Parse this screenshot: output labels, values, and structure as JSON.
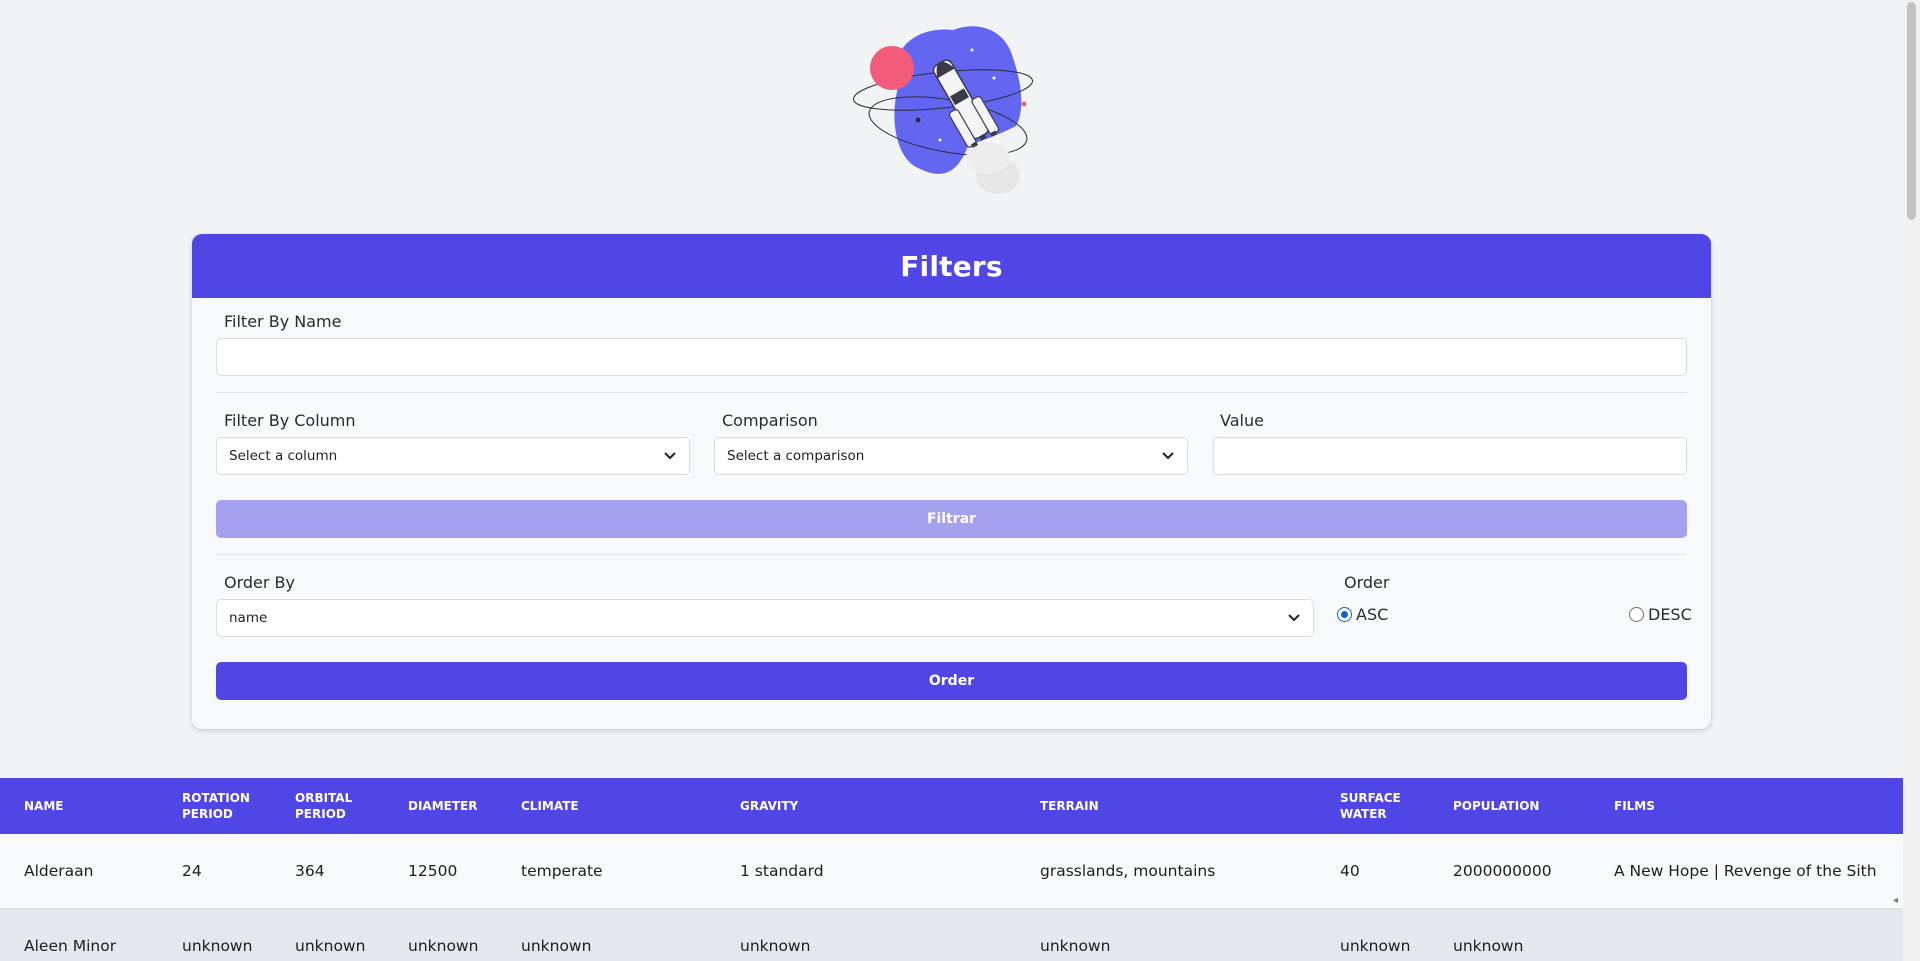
{
  "filters": {
    "title": "Filters",
    "name_label": "Filter By Name",
    "name_value": "",
    "column_label": "Filter By Column",
    "column_value": "Select a column",
    "comparison_label": "Comparison",
    "comparison_value": "Select a comparison",
    "value_label": "Value",
    "value_value": "",
    "filter_button": "Filtrar",
    "order_by_label": "Order By",
    "order_by_value": "name",
    "order_label": "Order",
    "asc_label": "ASC",
    "desc_label": "DESC",
    "order_selected": "ASC",
    "order_button": "Order"
  },
  "table": {
    "headers": [
      "Name",
      "Rotation Period",
      "Orbital Period",
      "Diameter",
      "Climate",
      "Gravity",
      "Terrain",
      "Surface Water",
      "Population",
      "Films"
    ],
    "rows": [
      [
        "Alderaan",
        "24",
        "364",
        "12500",
        "temperate",
        "1 standard",
        "grasslands, mountains",
        "40",
        "2000000000",
        "A New Hope | Revenge of the Sith"
      ],
      [
        "Aleen Minor",
        "unknown",
        "unknown",
        "unknown",
        "unknown",
        "unknown",
        "unknown",
        "unknown",
        "unknown",
        ""
      ]
    ]
  },
  "colors": {
    "primary": "#4f46e5",
    "primary_disabled": "#a5a1ef",
    "background": "#f2f3f5"
  },
  "icons": {
    "hero": "rocket-illustration",
    "select": "chevron-down-icon"
  }
}
